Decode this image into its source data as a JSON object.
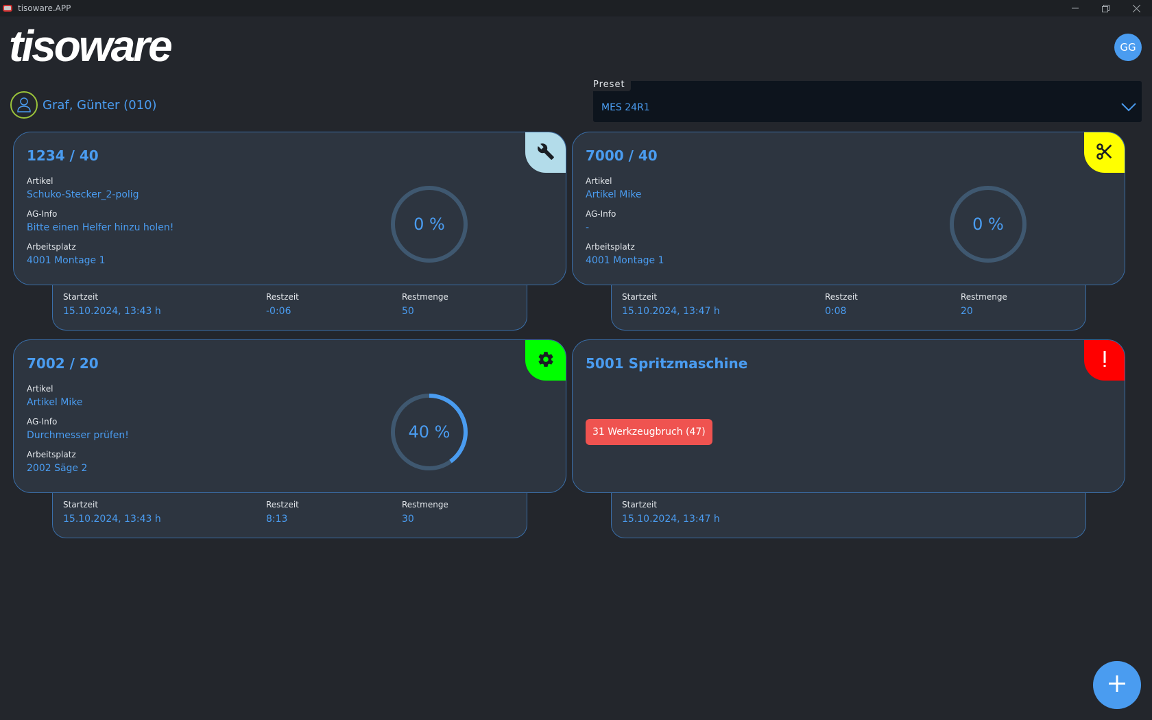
{
  "window": {
    "title": "tisoware.APP",
    "controls": [
      "minimize-icon",
      "restore-icon",
      "close-icon"
    ]
  },
  "header": {
    "logo": "tisoware",
    "avatar_initials": "GG"
  },
  "user": {
    "name": "Graf, Günter (010)"
  },
  "preset": {
    "label": "Preset",
    "value": "MES 24R1"
  },
  "cards": [
    {
      "title": "1234 / 40",
      "corner_icon": "wrench-icon",
      "corner_color": "#b3dcea",
      "fields": [
        {
          "label": "Artikel",
          "value": "Schuko-Stecker_2-polig"
        },
        {
          "label": "AG-Info",
          "value": "Bitte einen Helfer hinzu holen!"
        },
        {
          "label": "Arbeitsplatz",
          "value": "4001 Montage 1"
        }
      ],
      "progress_percent": 0,
      "progress_text": "0 %",
      "footer": [
        {
          "label": "Startzeit",
          "value": "15.10.2024, 13:43 h"
        },
        {
          "label": "Restzeit",
          "value": "-0:06"
        },
        {
          "label": "Restmenge",
          "value": "50"
        }
      ]
    },
    {
      "title": "7000 / 40",
      "corner_icon": "scissors-icon",
      "corner_color": "#ffff00",
      "fields": [
        {
          "label": "Artikel",
          "value": "Artikel Mike"
        },
        {
          "label": "AG-Info",
          "value": "-"
        },
        {
          "label": "Arbeitsplatz",
          "value": "4001 Montage 1"
        }
      ],
      "progress_percent": 0,
      "progress_text": "0 %",
      "footer": [
        {
          "label": "Startzeit",
          "value": "15.10.2024, 13:47 h"
        },
        {
          "label": "Restzeit",
          "value": "0:08"
        },
        {
          "label": "Restmenge",
          "value": "20"
        }
      ]
    },
    {
      "title": "7002 / 20",
      "corner_icon": "gear-icon",
      "corner_color": "#00ff00",
      "fields": [
        {
          "label": "Artikel",
          "value": "Artikel Mike"
        },
        {
          "label": "AG-Info",
          "value": "Durchmesser prüfen!"
        },
        {
          "label": "Arbeitsplatz",
          "value": "2002 Säge 2"
        }
      ],
      "progress_percent": 40,
      "progress_text": "40 %",
      "footer": [
        {
          "label": "Startzeit",
          "value": "15.10.2024, 13:43 h"
        },
        {
          "label": "Restzeit",
          "value": "8:13"
        },
        {
          "label": "Restmenge",
          "value": "30"
        }
      ]
    },
    {
      "title": "5001 Spritzmaschine",
      "corner_icon": "exclamation-icon",
      "corner_color": "#ff0000",
      "alarm": "31 Werkzeugbruch (47)",
      "footer": [
        {
          "label": "Startzeit",
          "value": "15.10.2024, 13:47 h"
        }
      ]
    }
  ],
  "fab": {
    "icon": "plus-icon"
  },
  "colors": {
    "background": "#23262c",
    "card": "#2d3540",
    "accent": "#4a9cf0",
    "ring_track": "#3f5870",
    "alarm": "#ef5350"
  }
}
